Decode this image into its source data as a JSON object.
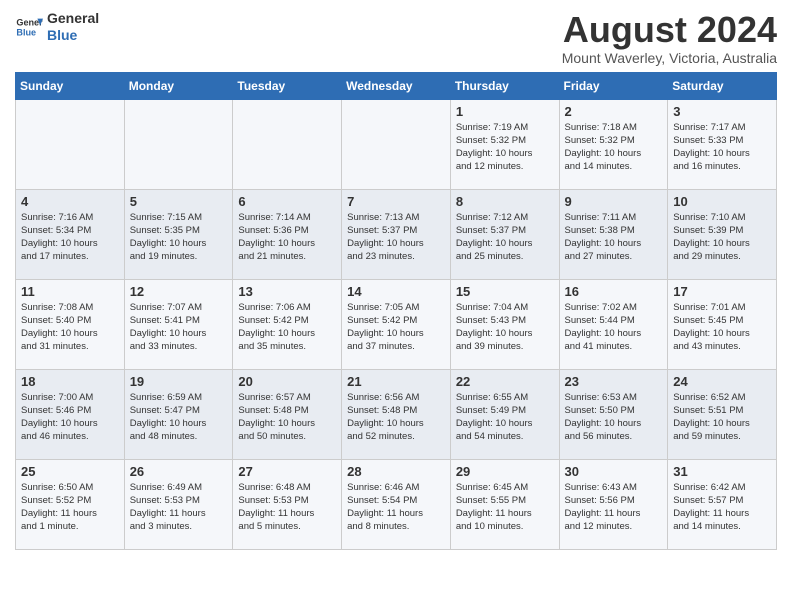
{
  "logo": {
    "text_general": "General",
    "text_blue": "Blue"
  },
  "header": {
    "month_year": "August 2024",
    "location": "Mount Waverley, Victoria, Australia"
  },
  "weekdays": [
    "Sunday",
    "Monday",
    "Tuesday",
    "Wednesday",
    "Thursday",
    "Friday",
    "Saturday"
  ],
  "weeks": [
    [
      {
        "day": "",
        "info": ""
      },
      {
        "day": "",
        "info": ""
      },
      {
        "day": "",
        "info": ""
      },
      {
        "day": "",
        "info": ""
      },
      {
        "day": "1",
        "info": "Sunrise: 7:19 AM\nSunset: 5:32 PM\nDaylight: 10 hours\nand 12 minutes."
      },
      {
        "day": "2",
        "info": "Sunrise: 7:18 AM\nSunset: 5:32 PM\nDaylight: 10 hours\nand 14 minutes."
      },
      {
        "day": "3",
        "info": "Sunrise: 7:17 AM\nSunset: 5:33 PM\nDaylight: 10 hours\nand 16 minutes."
      }
    ],
    [
      {
        "day": "4",
        "info": "Sunrise: 7:16 AM\nSunset: 5:34 PM\nDaylight: 10 hours\nand 17 minutes."
      },
      {
        "day": "5",
        "info": "Sunrise: 7:15 AM\nSunset: 5:35 PM\nDaylight: 10 hours\nand 19 minutes."
      },
      {
        "day": "6",
        "info": "Sunrise: 7:14 AM\nSunset: 5:36 PM\nDaylight: 10 hours\nand 21 minutes."
      },
      {
        "day": "7",
        "info": "Sunrise: 7:13 AM\nSunset: 5:37 PM\nDaylight: 10 hours\nand 23 minutes."
      },
      {
        "day": "8",
        "info": "Sunrise: 7:12 AM\nSunset: 5:37 PM\nDaylight: 10 hours\nand 25 minutes."
      },
      {
        "day": "9",
        "info": "Sunrise: 7:11 AM\nSunset: 5:38 PM\nDaylight: 10 hours\nand 27 minutes."
      },
      {
        "day": "10",
        "info": "Sunrise: 7:10 AM\nSunset: 5:39 PM\nDaylight: 10 hours\nand 29 minutes."
      }
    ],
    [
      {
        "day": "11",
        "info": "Sunrise: 7:08 AM\nSunset: 5:40 PM\nDaylight: 10 hours\nand 31 minutes."
      },
      {
        "day": "12",
        "info": "Sunrise: 7:07 AM\nSunset: 5:41 PM\nDaylight: 10 hours\nand 33 minutes."
      },
      {
        "day": "13",
        "info": "Sunrise: 7:06 AM\nSunset: 5:42 PM\nDaylight: 10 hours\nand 35 minutes."
      },
      {
        "day": "14",
        "info": "Sunrise: 7:05 AM\nSunset: 5:42 PM\nDaylight: 10 hours\nand 37 minutes."
      },
      {
        "day": "15",
        "info": "Sunrise: 7:04 AM\nSunset: 5:43 PM\nDaylight: 10 hours\nand 39 minutes."
      },
      {
        "day": "16",
        "info": "Sunrise: 7:02 AM\nSunset: 5:44 PM\nDaylight: 10 hours\nand 41 minutes."
      },
      {
        "day": "17",
        "info": "Sunrise: 7:01 AM\nSunset: 5:45 PM\nDaylight: 10 hours\nand 43 minutes."
      }
    ],
    [
      {
        "day": "18",
        "info": "Sunrise: 7:00 AM\nSunset: 5:46 PM\nDaylight: 10 hours\nand 46 minutes."
      },
      {
        "day": "19",
        "info": "Sunrise: 6:59 AM\nSunset: 5:47 PM\nDaylight: 10 hours\nand 48 minutes."
      },
      {
        "day": "20",
        "info": "Sunrise: 6:57 AM\nSunset: 5:48 PM\nDaylight: 10 hours\nand 50 minutes."
      },
      {
        "day": "21",
        "info": "Sunrise: 6:56 AM\nSunset: 5:48 PM\nDaylight: 10 hours\nand 52 minutes."
      },
      {
        "day": "22",
        "info": "Sunrise: 6:55 AM\nSunset: 5:49 PM\nDaylight: 10 hours\nand 54 minutes."
      },
      {
        "day": "23",
        "info": "Sunrise: 6:53 AM\nSunset: 5:50 PM\nDaylight: 10 hours\nand 56 minutes."
      },
      {
        "day": "24",
        "info": "Sunrise: 6:52 AM\nSunset: 5:51 PM\nDaylight: 10 hours\nand 59 minutes."
      }
    ],
    [
      {
        "day": "25",
        "info": "Sunrise: 6:50 AM\nSunset: 5:52 PM\nDaylight: 11 hours\nand 1 minute."
      },
      {
        "day": "26",
        "info": "Sunrise: 6:49 AM\nSunset: 5:53 PM\nDaylight: 11 hours\nand 3 minutes."
      },
      {
        "day": "27",
        "info": "Sunrise: 6:48 AM\nSunset: 5:53 PM\nDaylight: 11 hours\nand 5 minutes."
      },
      {
        "day": "28",
        "info": "Sunrise: 6:46 AM\nSunset: 5:54 PM\nDaylight: 11 hours\nand 8 minutes."
      },
      {
        "day": "29",
        "info": "Sunrise: 6:45 AM\nSunset: 5:55 PM\nDaylight: 11 hours\nand 10 minutes."
      },
      {
        "day": "30",
        "info": "Sunrise: 6:43 AM\nSunset: 5:56 PM\nDaylight: 11 hours\nand 12 minutes."
      },
      {
        "day": "31",
        "info": "Sunrise: 6:42 AM\nSunset: 5:57 PM\nDaylight: 11 hours\nand 14 minutes."
      }
    ]
  ]
}
